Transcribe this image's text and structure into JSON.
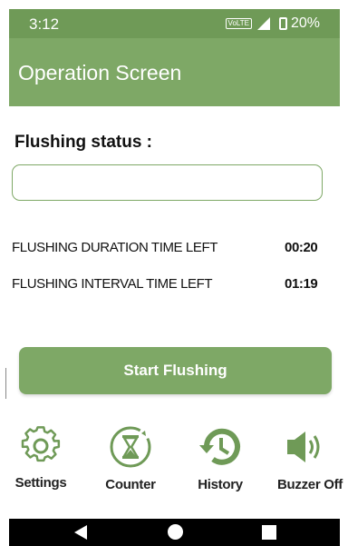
{
  "status_bar": {
    "time": "3:12",
    "network": "VoLTE",
    "network_gen": "4G",
    "battery": "20%"
  },
  "app_bar": {
    "title": "Operation Screen"
  },
  "flushing": {
    "label": "Flushing status :",
    "value": ""
  },
  "rows": [
    {
      "label": "FLUSHING DURATION TIME LEFT",
      "value": "00:20"
    },
    {
      "label": "FLUSHING INTERVAL TIME LEFT",
      "value": "01:19"
    }
  ],
  "start_button": {
    "label": "Start Flushing"
  },
  "bottom_nav": [
    {
      "label": "Settings",
      "icon": "gear-icon"
    },
    {
      "label": "Counter",
      "icon": "hourglass-icon"
    },
    {
      "label": "History",
      "icon": "history-icon"
    },
    {
      "label": "Buzzer Off",
      "icon": "speaker-icon"
    }
  ],
  "colors": {
    "primary": "#7ea866",
    "status_bar": "#6f9a57",
    "system_nav": "#000000"
  }
}
